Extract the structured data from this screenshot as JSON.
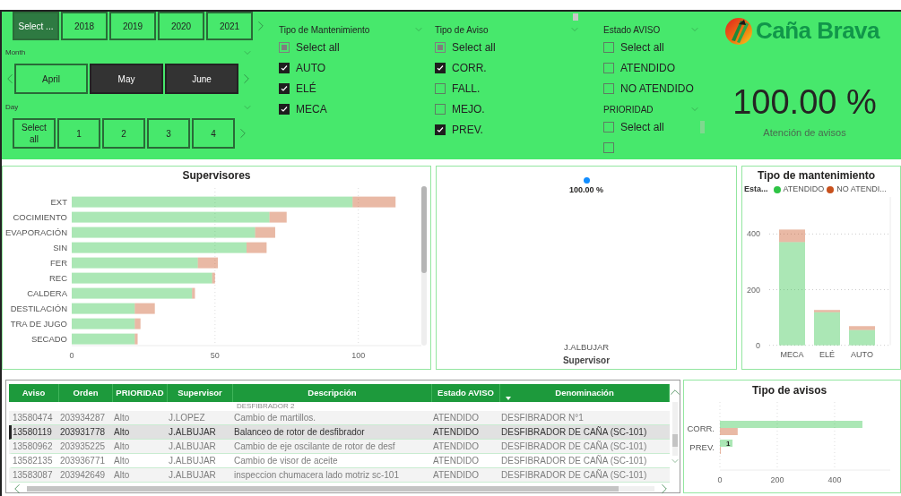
{
  "filters": {
    "year_buttons": [
      {
        "label": "Select ...",
        "selected": true
      },
      {
        "label": "2018",
        "selected": false
      },
      {
        "label": "2019",
        "selected": false
      },
      {
        "label": "2020",
        "selected": false
      },
      {
        "label": "2021",
        "selected": false
      }
    ],
    "month": {
      "title": "Month",
      "items": [
        {
          "label": "April",
          "selected": false
        },
        {
          "label": "May",
          "selected": true
        },
        {
          "label": "June",
          "selected": true
        }
      ]
    },
    "day": {
      "title": "Day",
      "items": [
        {
          "label": "Select all",
          "selected": false
        },
        {
          "label": "1",
          "selected": false
        },
        {
          "label": "2",
          "selected": false
        },
        {
          "label": "3",
          "selected": false
        },
        {
          "label": "4",
          "selected": false
        }
      ]
    }
  },
  "slicers": [
    {
      "title": "Tipo de Mantenimiento",
      "select_all": {
        "label": "Select all",
        "partial": true
      },
      "items": [
        {
          "label": "AUTO",
          "checked": true
        },
        {
          "label": "ELÉ",
          "checked": true
        },
        {
          "label": "MECA",
          "checked": true
        }
      ]
    },
    {
      "title": "Tipo de Aviso",
      "select_all": {
        "label": "Select all",
        "partial": true
      },
      "items": [
        {
          "label": "CORR.",
          "checked": true
        },
        {
          "label": "FALL.",
          "checked": false
        },
        {
          "label": "MEJO.",
          "checked": false
        },
        {
          "label": "PREV.",
          "checked": true
        }
      ]
    },
    {
      "title": "Estado AVISO",
      "select_all": {
        "label": "Select all",
        "partial": false
      },
      "items": [
        {
          "label": "ATENDIDO",
          "checked": false
        },
        {
          "label": "NO ATENDIDO",
          "checked": false
        }
      ]
    },
    {
      "title": "PRIORIDAD",
      "select_all": {
        "label": "Select all",
        "partial": false
      },
      "items": [
        {
          "checked": false
        }
      ]
    }
  ],
  "logo": {
    "text": "Caña Brava"
  },
  "kpi": {
    "value": "100.00 %",
    "label": "Atención de avisos"
  },
  "supervisores": {
    "chart_data": {
      "type": "bar",
      "orientation": "horizontal",
      "stacked": true,
      "title": "Supervisores",
      "categories": [
        "EXT",
        "COCIMIENTO",
        "EVAPORACIÓN",
        "SIN",
        "FER",
        "REC",
        "CALDERA",
        "DESTILACIÓN",
        "TRA DE JUGO",
        "SECADO"
      ],
      "series": [
        {
          "color": "#2ec445",
          "values": [
            98,
            69,
            64,
            61,
            44,
            49,
            42,
            22,
            22,
            22
          ]
        },
        {
          "color": "#c8511d",
          "values": [
            15,
            6,
            7,
            7,
            7,
            1,
            1,
            7,
            2,
            1
          ]
        }
      ],
      "xlim": [
        0,
        122
      ],
      "xticks": [
        0,
        50,
        100
      ]
    }
  },
  "scatter": {
    "point_label": "100.00 %",
    "category": "J.ALBUJAR",
    "axis_title": "Supervisor"
  },
  "mantenimiento": {
    "legend_title": "Esta...",
    "chart_data": {
      "type": "bar",
      "orientation": "vertical",
      "stacked": true,
      "title": "Tipo de mantenimiento",
      "categories": [
        "MECA",
        "ELÉ",
        "AUTO"
      ],
      "series": [
        {
          "name": "ATENDIDO",
          "color": "#2ec445",
          "values": [
            371,
            119,
            55
          ]
        },
        {
          "name": "NO ATENDI...",
          "color": "#c8511d",
          "values": [
            45,
            8,
            14
          ]
        }
      ],
      "ylim": [
        0,
        533
      ],
      "yticks": [
        0,
        200,
        400
      ]
    }
  },
  "table": {
    "columns": [
      "Aviso",
      "Orden",
      "PRIORIDAD",
      "Supervisor",
      "Descripción",
      "Estado AVISO",
      "Denominación"
    ],
    "rows": [
      {
        "kind": "cut",
        "text": "DESFIBRADOR 2",
        "selected": false
      },
      {
        "kind": "row",
        "selected": false,
        "cells": [
          "13580474",
          "203934287",
          "Alto",
          "J.LOPEZ",
          "Cambio de martillos.",
          "ATENDIDO",
          "DESFIBRADOR N°1"
        ]
      },
      {
        "kind": "row",
        "selected": true,
        "cells": [
          "13580119",
          "203931778",
          "Alto",
          "J.ALBUJAR",
          "Balanceo de rotor de desfibrador",
          "ATENDIDO",
          "DESFIBRADOR DE CAÑA (SC-101)"
        ]
      },
      {
        "kind": "row",
        "selected": false,
        "cells": [
          "13580962",
          "203935225",
          "Alto",
          "J.ALBUJAR",
          "Cambio de eje oscilante de rotor de desf",
          "ATENDIDO",
          "DESFIBRADOR DE CAÑA (SC-101)"
        ]
      },
      {
        "kind": "row",
        "selected": false,
        "cells": [
          "13582135",
          "203936771",
          "Alto",
          "J.ALBUJAR",
          "Cambio de visor de aceite",
          "ATENDIDO",
          "DESFIBRADOR DE CAÑA (SC-101)"
        ]
      },
      {
        "kind": "row",
        "selected": false,
        "cells": [
          "13583087",
          "203942649",
          "Alto",
          "J.ALBUJAR",
          "inspeccion chumacera lado motriz sc-101",
          "ATENDIDO",
          "DESFIBRADOR DE CAÑA (SC-101)"
        ]
      }
    ]
  },
  "avisos": {
    "chart_data": {
      "type": "bar",
      "orientation": "horizontal",
      "stacked": false,
      "title": "Tipo de avisos",
      "categories": [
        "CORR.",
        "PREV."
      ],
      "series": [
        {
          "color": "#2ec445",
          "values": [
            497,
            44
          ]
        },
        {
          "color": "#c8511d",
          "values": [
            62,
            1
          ]
        }
      ],
      "xlim": [
        0,
        594
      ],
      "xticks": [
        0,
        200,
        400
      ],
      "annotations": [
        {
          "text": "1"
        }
      ]
    }
  }
}
